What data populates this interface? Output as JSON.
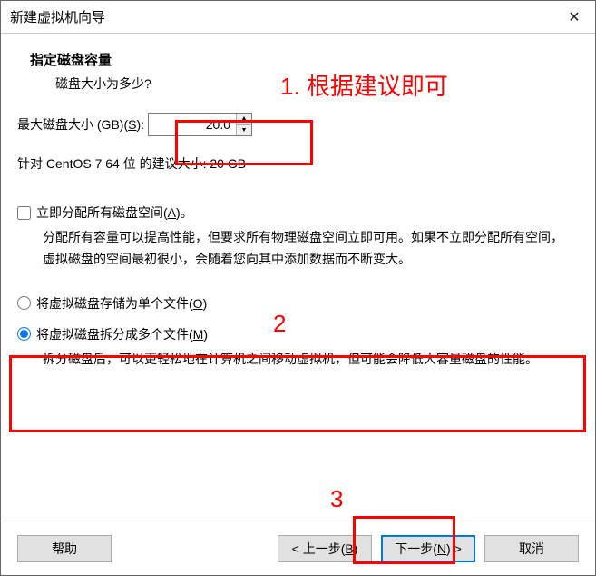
{
  "window": {
    "title": "新建虚拟机向导",
    "close_glyph": "✕"
  },
  "header": {
    "title": "指定磁盘容量",
    "subtitle": "磁盘大小为多少?"
  },
  "disk": {
    "label_pre": "最大磁盘大小 (GB)(",
    "label_hotkey": "S",
    "label_post": "):",
    "value": "20.0",
    "recommendation": "针对 CentOS 7 64 位 的建议大小: 20 GB"
  },
  "allocate": {
    "label_pre": "立即分配所有磁盘空间(",
    "label_hotkey": "A",
    "label_post": ")。",
    "desc": "分配所有容量可以提高性能，但要求所有物理磁盘空间立即可用。如果不立即分配所有空间，虚拟磁盘的空间最初很小，会随着您向其中添加数据而不断变大。"
  },
  "store": {
    "single_pre": "将虚拟磁盘存储为单个文件(",
    "single_hotkey": "O",
    "single_post": ")",
    "split_pre": "将虚拟磁盘拆分成多个文件(",
    "split_hotkey": "M",
    "split_post": ")",
    "split_desc": "拆分磁盘后，可以更轻松地在计算机之间移动虚拟机，但可能会降低大容量磁盘的性能。"
  },
  "footer": {
    "help": "帮助",
    "back_pre": "< 上一步(",
    "back_hotkey": "B",
    "back_post": ")",
    "next_pre": "下一步(",
    "next_hotkey": "N",
    "next_post": ") >",
    "cancel": "取消"
  },
  "annotations": {
    "a1": "1. 根据建议即可",
    "a2": "2",
    "a3": "3"
  }
}
